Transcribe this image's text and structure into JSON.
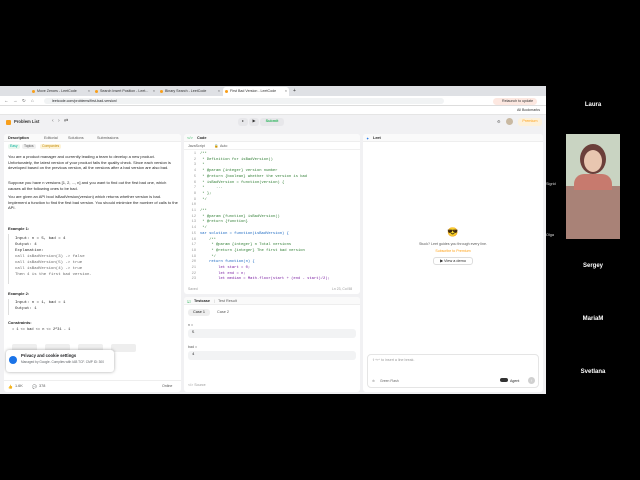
{
  "browser": {
    "tabs": [
      {
        "label": "Move Zeroes - LeetCode"
      },
      {
        "label": "Search Insert Position - Leet..."
      },
      {
        "label": "Binary Search - LeetCode"
      },
      {
        "label": "First Bad Version - LeetCode"
      }
    ],
    "url": "leetcode.com/problems/first-bad-version/",
    "relaunch_label": "Relaunch to update",
    "all_bookmarks": "All Bookmarks"
  },
  "lc_toolbar": {
    "problem_list": "Problem List",
    "submit": "Submit",
    "premium": "Premium"
  },
  "problem": {
    "tabs": [
      "Description",
      "Editorial",
      "Solutions",
      "Submissions"
    ],
    "tags": [
      "Easy",
      "Topics",
      "Companies"
    ],
    "para1": "You are a product manager and currently leading a team to develop a new product. Unfortunately, the latest version of your product fails the quality check. Since each version is developed based on the previous version, all the versions after a bad version are also bad.",
    "para2": "Suppose you have n versions [1, 2, ..., n] and you want to find out the first bad one, which causes all the following ones to be bad.",
    "para3": "You are given an API bool isBadVersion(version) which returns whether version is bad. Implement a function to find the first bad version. You should minimize the number of calls to the API.",
    "ex1_title": "Example 1:",
    "ex1_lines": [
      "Input: n = 5, bad = 4",
      "Output: 4",
      "Explanation:",
      "call isBadVersion(3) -> false",
      "call isBadVersion(5) -> true",
      "call isBadVersion(4) -> true",
      "Then 4 is the first bad version."
    ],
    "ex2_title": "Example 2:",
    "ex2_lines": [
      "Input: n = 1, bad = 1",
      "Output: 1"
    ],
    "constraints_title": "Constraints:",
    "constraint": "1 <= bad <= n <= 2^31 - 1",
    "likes": "1.6K",
    "dislikes": "378",
    "online": "Online"
  },
  "privacy": {
    "title": "Privacy and cookie settings",
    "sub": "Managed by Google. Complies with IAB TCF. CMP ID: 300"
  },
  "code": {
    "title": "Code",
    "language": "JavaScript",
    "mode": "Auto",
    "lines": [
      {
        "n": "1",
        "t": "/**",
        "c": "green"
      },
      {
        "n": "2",
        "t": " * Definition for isBadVersion()",
        "c": "green"
      },
      {
        "n": "3",
        "t": " *",
        "c": "green"
      },
      {
        "n": "4",
        "t": " * @param {integer} version number",
        "c": "green"
      },
      {
        "n": "5",
        "t": " * @return {boolean} whether the version is bad",
        "c": "green"
      },
      {
        "n": "6",
        "t": " * isBadVersion = function(version) {",
        "c": "green"
      },
      {
        "n": "7",
        "t": " *     ...",
        "c": "green"
      },
      {
        "n": "8",
        "t": " * };",
        "c": "green"
      },
      {
        "n": "9",
        "t": " */",
        "c": "green"
      },
      {
        "n": "10",
        "t": "",
        "c": ""
      },
      {
        "n": "11",
        "t": "/**",
        "c": "green"
      },
      {
        "n": "12",
        "t": " * @param {function} isBadVersion()",
        "c": "green"
      },
      {
        "n": "13",
        "t": " * @return {function}",
        "c": "green"
      },
      {
        "n": "14",
        "t": " */",
        "c": "green"
      },
      {
        "n": "15",
        "t": "var solution = function(isBadVersion) {",
        "c": "blue"
      },
      {
        "n": "16",
        "t": "    /**",
        "c": "green"
      },
      {
        "n": "17",
        "t": "     * @param {integer} n Total versions",
        "c": "green"
      },
      {
        "n": "18",
        "t": "     * @return {integer} The first bad version",
        "c": "green"
      },
      {
        "n": "19",
        "t": "     */",
        "c": "green"
      },
      {
        "n": "20",
        "t": "    return function(n) {",
        "c": "blue"
      },
      {
        "n": "21",
        "t": "        let start = 0;",
        "c": "purple"
      },
      {
        "n": "22",
        "t": "        let end = n;",
        "c": "purple"
      },
      {
        "n": "23",
        "t": "        let median = Math.floor(start + (end - start)/2);",
        "c": "purple"
      }
    ],
    "position": "Ln 23, Col 58",
    "saved": "Saved"
  },
  "testcase": {
    "tab": "Testcase",
    "result_tab": "Test Result",
    "cases": [
      "Case 1",
      "Case 2"
    ],
    "n_label": "n =",
    "n_value": "5",
    "bad_label": "bad =",
    "bad_value": "4",
    "source": "Source"
  },
  "leed": {
    "title": "Leet",
    "emoji": "😎",
    "message": "Stuck? Leet guides you through every line.",
    "subscribe": "Subscribe to Premium",
    "demo_button": "View a demo",
    "input_placeholder": "⇧+↵ to insert a line break.",
    "mode_label": "Green Flash",
    "agent_label": "Agent"
  },
  "participants": [
    "Laura",
    "Sergey",
    "MariaM",
    "Svetlana"
  ],
  "tile_labels": [
    "Sigrid",
    "Olga"
  ]
}
